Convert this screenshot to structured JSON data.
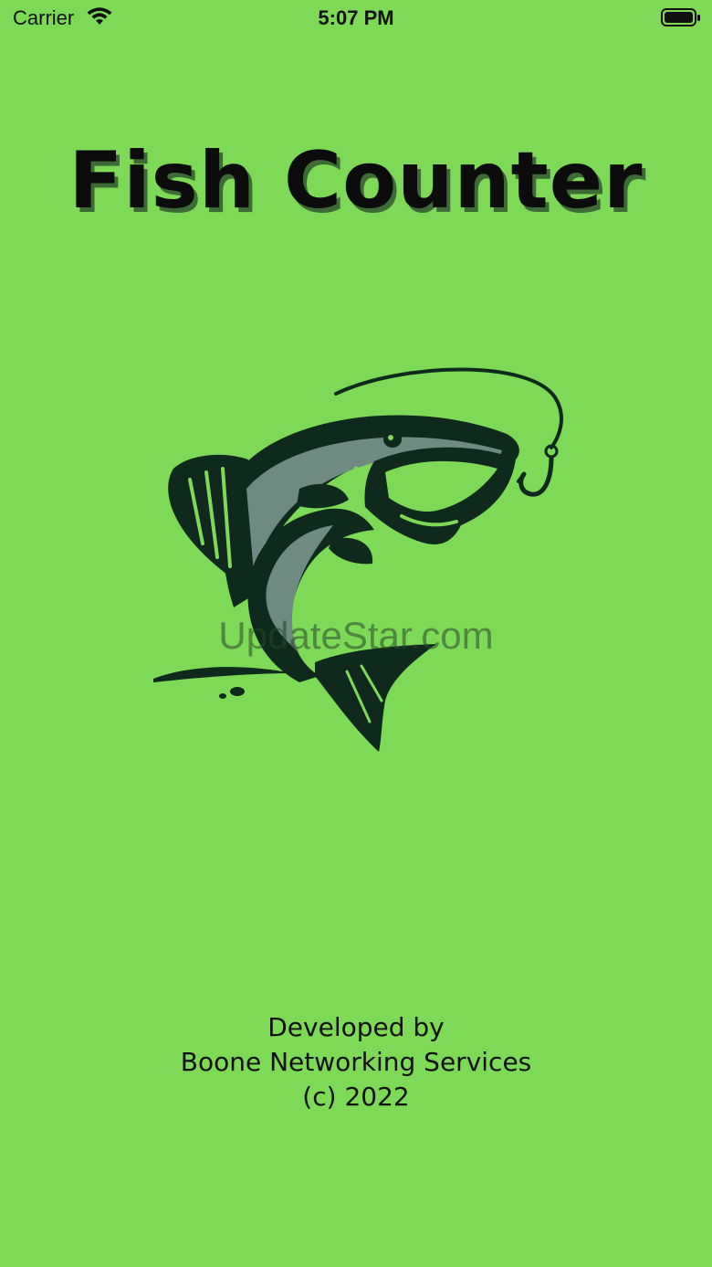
{
  "status_bar": {
    "carrier": "Carrier",
    "time": "5:07 PM",
    "wifi_icon": "wifi-icon",
    "battery_icon": "battery-full-icon"
  },
  "app": {
    "title": "Fish Counter",
    "logo_icon": "jumping-fish-hook-icon"
  },
  "watermark": "UpdateStar.com",
  "credits": {
    "line1": "Developed by",
    "line2": "Boone Networking Services",
    "line3": "(c) 2022"
  },
  "colors": {
    "background": "#7ed957",
    "text": "#111111",
    "fish_dark": "#0f2a1c",
    "fish_grey": "#6f8a80"
  }
}
